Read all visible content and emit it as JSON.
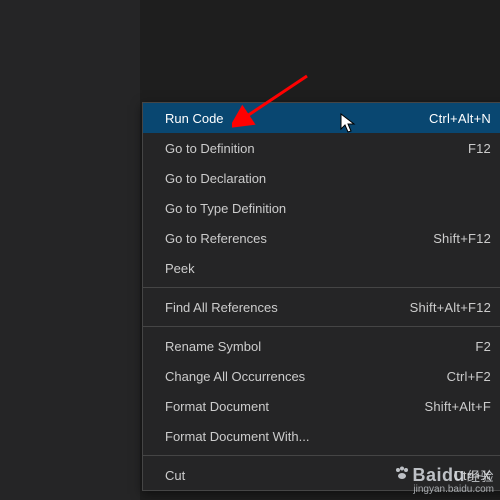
{
  "menu": {
    "groups": [
      [
        {
          "label": "Run Code",
          "shortcut": "Ctrl+Alt+N",
          "highlight": true,
          "name": "run-code"
        },
        {
          "label": "Go to Definition",
          "shortcut": "F12",
          "name": "go-to-definition"
        },
        {
          "label": "Go to Declaration",
          "shortcut": "",
          "name": "go-to-declaration"
        },
        {
          "label": "Go to Type Definition",
          "shortcut": "",
          "name": "go-to-type-definition"
        },
        {
          "label": "Go to References",
          "shortcut": "Shift+F12",
          "name": "go-to-references"
        },
        {
          "label": "Peek",
          "shortcut": "",
          "name": "peek"
        }
      ],
      [
        {
          "label": "Find All References",
          "shortcut": "Shift+Alt+F12",
          "name": "find-all-references"
        }
      ],
      [
        {
          "label": "Rename Symbol",
          "shortcut": "F2",
          "name": "rename-symbol"
        },
        {
          "label": "Change All Occurrences",
          "shortcut": "Ctrl+F2",
          "name": "change-all-occurrences"
        },
        {
          "label": "Format Document",
          "shortcut": "Shift+Alt+F",
          "name": "format-document"
        },
        {
          "label": "Format Document With...",
          "shortcut": "",
          "name": "format-document-with"
        }
      ],
      [
        {
          "label": "Cut",
          "shortcut": "Ctrl+X",
          "name": "cut"
        }
      ]
    ]
  },
  "watermark": {
    "brand": "Baidu",
    "sub": "经验",
    "url": "jingyan.baidu.com"
  }
}
